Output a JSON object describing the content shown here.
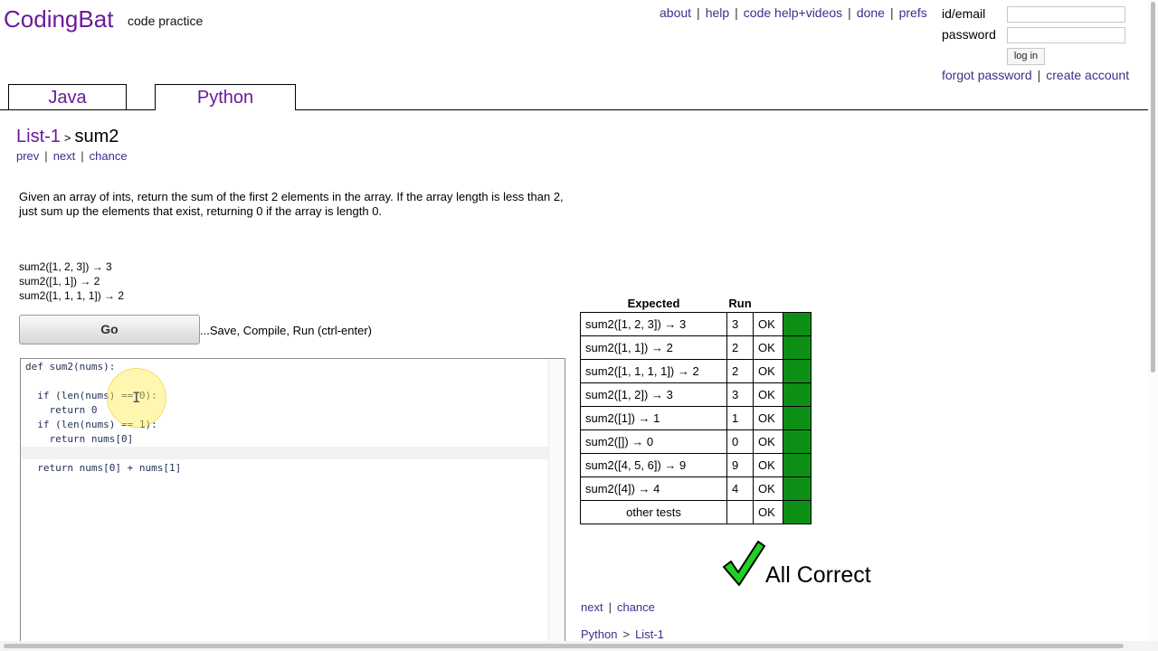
{
  "header": {
    "logo": "CodingBat",
    "tagline": "code practice",
    "nav": [
      "about",
      "help",
      "code help+videos",
      "done",
      "prefs"
    ],
    "login": {
      "id_label": "id/email",
      "password_label": "password",
      "button": "log in",
      "forgot": "forgot password",
      "create": "create account"
    }
  },
  "tabs": [
    "Java",
    "Python"
  ],
  "problem": {
    "section": "List-1",
    "name": "sum2",
    "nav": [
      "prev",
      "next",
      "chance"
    ],
    "description": "Given an array of ints, return the sum of the first 2 elements in the array. If the array length is less than 2, just sum up the elements that exist, returning 0 if the array is length 0.",
    "examples": [
      "sum2([1, 2, 3]) → 3",
      "sum2([1, 1]) → 2",
      "sum2([1, 1, 1, 1]) → 2"
    ]
  },
  "go": {
    "label": "Go",
    "hint": "...Save, Compile, Run (ctrl-enter)"
  },
  "editor": {
    "lines": [
      "def sum2(nums):",
      "",
      "  if (len(nums) == 0):",
      "    return 0",
      "  if (len(nums) == 1):",
      "    return nums[0]",
      "",
      "  return nums[0] + nums[1]"
    ]
  },
  "results": {
    "headers": [
      "Expected",
      "Run"
    ],
    "rows": [
      {
        "expected": "sum2([1, 2, 3]) → 3",
        "run": "3",
        "status": "OK"
      },
      {
        "expected": "sum2([1, 1]) → 2",
        "run": "2",
        "status": "OK"
      },
      {
        "expected": "sum2([1, 1, 1, 1]) → 2",
        "run": "2",
        "status": "OK"
      },
      {
        "expected": "sum2([1, 2]) → 3",
        "run": "3",
        "status": "OK"
      },
      {
        "expected": "sum2([1]) → 1",
        "run": "1",
        "status": "OK"
      },
      {
        "expected": "sum2([]) → 0",
        "run": "0",
        "status": "OK"
      },
      {
        "expected": "sum2([4, 5, 6]) → 9",
        "run": "9",
        "status": "OK"
      },
      {
        "expected": "sum2([4]) → 4",
        "run": "4",
        "status": "OK"
      },
      {
        "expected": "other tests",
        "run": "",
        "status": "OK"
      }
    ],
    "summary": "All Correct",
    "pass_color": "#0d8f16"
  },
  "footer": {
    "nav": [
      "next",
      "chance"
    ],
    "crumb": [
      "Python",
      "List-1"
    ]
  },
  "colors": {
    "link": "#3f2e8c",
    "logo": "#6a1b9a",
    "pass": "#0d8f16"
  }
}
